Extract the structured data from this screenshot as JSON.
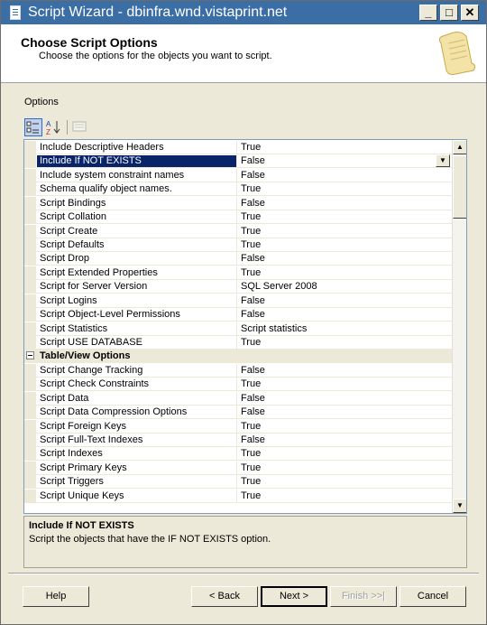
{
  "window": {
    "title": "Script Wizard - dbinfra.wnd.vistaprint.net"
  },
  "header": {
    "title": "Choose Script Options",
    "subtitle": "Choose the options for the objects you want to script."
  },
  "options_label": "Options",
  "toolbar": {
    "categorized_icon": "categorized-icon",
    "alphabetical_icon": "alphabetical-sort-icon",
    "property_pages_icon": "property-pages-icon"
  },
  "grid": {
    "general_rows": [
      {
        "name": "Include Descriptive Headers",
        "value": "True"
      },
      {
        "name": "Include If NOT EXISTS",
        "value": "False"
      },
      {
        "name": "Include system constraint names",
        "value": "False"
      },
      {
        "name": "Schema qualify object names.",
        "value": "True"
      },
      {
        "name": "Script Bindings",
        "value": "False"
      },
      {
        "name": "Script Collation",
        "value": "True"
      },
      {
        "name": "Script Create",
        "value": "True"
      },
      {
        "name": "Script Defaults",
        "value": "True"
      },
      {
        "name": "Script Drop",
        "value": "False"
      },
      {
        "name": "Script Extended Properties",
        "value": "True"
      },
      {
        "name": "Script for Server Version",
        "value": "SQL Server 2008"
      },
      {
        "name": "Script Logins",
        "value": "False"
      },
      {
        "name": "Script Object-Level Permissions",
        "value": "False"
      },
      {
        "name": "Script Statistics",
        "value": "Script statistics"
      },
      {
        "name": "Script USE DATABASE",
        "value": "True"
      }
    ],
    "category": {
      "name": "Table/View Options"
    },
    "table_rows": [
      {
        "name": "Script Change Tracking",
        "value": "False"
      },
      {
        "name": "Script Check Constraints",
        "value": "True"
      },
      {
        "name": "Script Data",
        "value": "False"
      },
      {
        "name": "Script Data Compression Options",
        "value": "False"
      },
      {
        "name": "Script Foreign Keys",
        "value": "True"
      },
      {
        "name": "Script Full-Text Indexes",
        "value": "False"
      },
      {
        "name": "Script Indexes",
        "value": "True"
      },
      {
        "name": "Script Primary Keys",
        "value": "True"
      },
      {
        "name": "Script Triggers",
        "value": "True"
      },
      {
        "name": "Script Unique Keys",
        "value": "True"
      }
    ]
  },
  "description": {
    "title": "Include If NOT EXISTS",
    "text": "Script the objects that have the IF NOT EXISTS option."
  },
  "buttons": {
    "help": "Help",
    "back": "< Back",
    "next": "Next >",
    "finish": "Finish >>|",
    "cancel": "Cancel"
  },
  "colors": {
    "title_bar": "#3a6ea5",
    "selection": "#0a246a",
    "window_bg": "#ece9d8"
  }
}
